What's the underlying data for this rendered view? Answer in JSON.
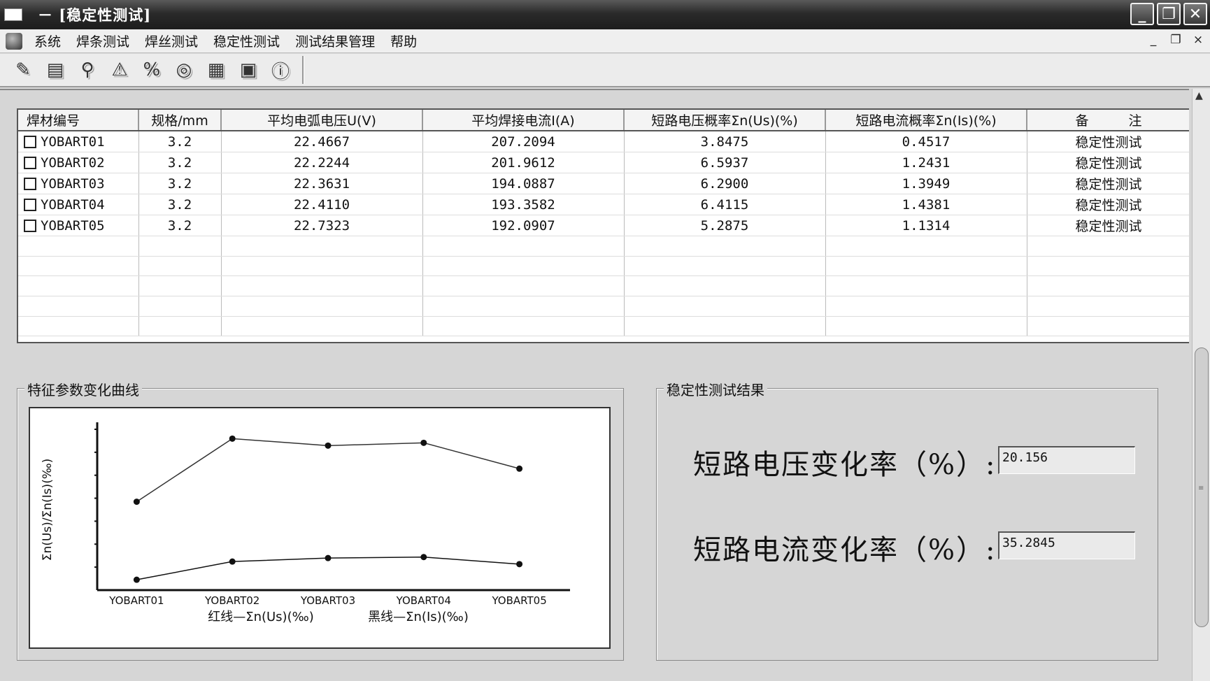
{
  "window": {
    "title": "－ [稳定性测试]"
  },
  "menu": [
    "系统",
    "焊条测试",
    "焊丝测试",
    "稳定性测试",
    "测试结果管理",
    "帮助"
  ],
  "mdi_buttons": {
    "minimize": "_",
    "restore": "❐",
    "close": "×"
  },
  "toolbar": {
    "icons": [
      "edit-icon",
      "folder-icon",
      "search-icon",
      "instrument-icon",
      "percent-icon",
      "cycle-icon",
      "report-icon",
      "export-icon",
      "info-icon"
    ]
  },
  "table": {
    "headers": [
      "焊材编号",
      "规格/mm",
      "平均电弧电压U(V)",
      "平均焊接电流I(A)",
      "短路电压概率Σn(Us)(%)",
      "短路电流概率Σn(Is)(%)",
      "备　　　注"
    ],
    "rows": [
      [
        "YOBART01",
        "3.2",
        "22.4667",
        "207.2094",
        "3.8475",
        "0.4517",
        "稳定性测试"
      ],
      [
        "YOBART02",
        "3.2",
        "22.2244",
        "201.9612",
        "6.5937",
        "1.2431",
        "稳定性测试"
      ],
      [
        "YOBART03",
        "3.2",
        "22.3631",
        "194.0887",
        "6.2900",
        "1.3949",
        "稳定性测试"
      ],
      [
        "YOBART04",
        "3.2",
        "22.4110",
        "193.3582",
        "6.4115",
        "1.4381",
        "稳定性测试"
      ],
      [
        "YOBART05",
        "3.2",
        "22.7323",
        "192.0907",
        "5.2875",
        "1.1314",
        "稳定性测试"
      ]
    ],
    "empty_rows": 5
  },
  "chart_group": {
    "title": "特征参数变化曲线"
  },
  "chart_data": {
    "type": "line",
    "categories": [
      "YOBART01",
      "YOBART02",
      "YOBART03",
      "YOBART04",
      "YOBART05"
    ],
    "series": [
      {
        "name": "红线—Σn(Us)(‰)",
        "values": [
          3.8475,
          6.5937,
          6.29,
          6.4115,
          5.2875
        ],
        "color": "#333333"
      },
      {
        "name": "黑线—Σn(Is)(‰)",
        "values": [
          0.4517,
          1.2431,
          1.3949,
          1.4381,
          1.1314
        ],
        "color": "#111111"
      }
    ],
    "ylabel": "Σn(Us)/Σn(Is)(‰)",
    "legend": [
      "红线—Σn(Us)(‰)",
      "黑线—Σn(Is)(‰)"
    ],
    "ylim": [
      0,
      7
    ],
    "y_ticks": 7
  },
  "result_group": {
    "title": "稳定性测试结果",
    "voltage_label": "短路电压变化率（%）:",
    "voltage_value": "20.156",
    "current_label": "短路电流变化率（%）:",
    "current_value": "35.2845"
  }
}
